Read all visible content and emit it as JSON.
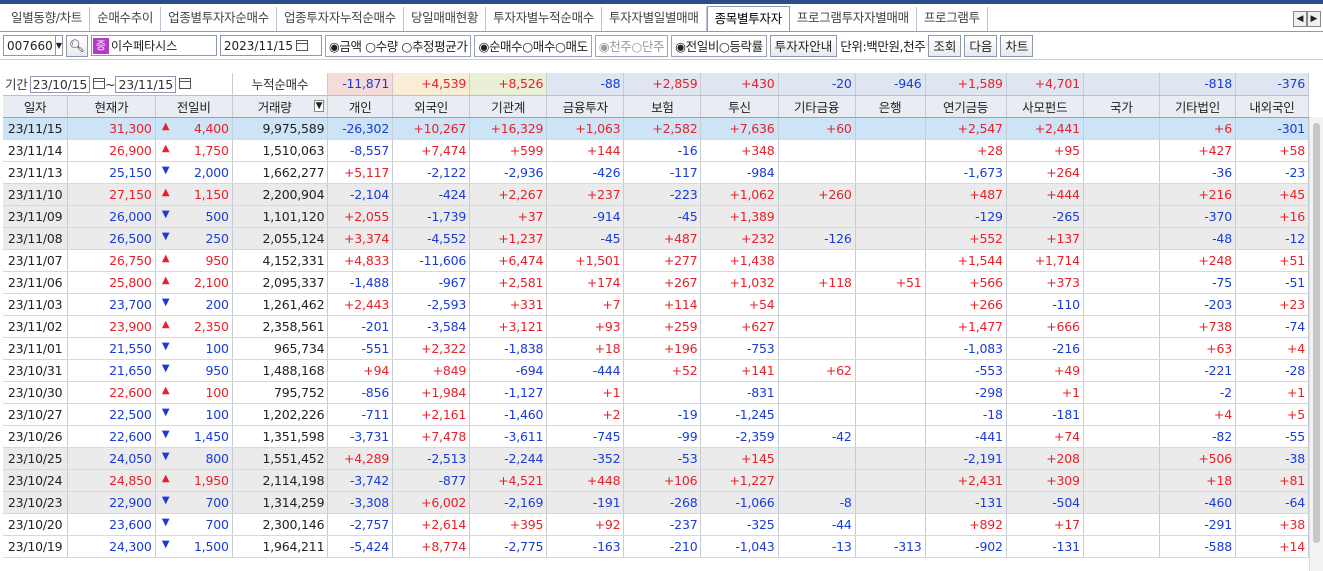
{
  "tabs": [
    "일별동향/차트",
    "순매수추이",
    "업종별투자자순매수",
    "업종투자자누적순매수",
    "당일매매현황",
    "투자자별누적순매수",
    "투자자별일별매매",
    "종목별투자자",
    "프로그램투자자별매매",
    "프로그램투"
  ],
  "active_tab": 7,
  "toolbar": {
    "code": "007660",
    "badge": "증",
    "name": "이수페타시스",
    "date": "2023/11/15",
    "r1": "◉금액 ○수량 ○추정평균가",
    "r2": "◉순매수○매수○매도",
    "r3": "◉천주○단주",
    "r4": "◉전일비○등락률",
    "guide": "투자자안내",
    "unit": "단위:백만원,천주",
    "query": "조회",
    "next": "다음",
    "chart": "차트"
  },
  "period": {
    "label": "기간",
    "from": "23/10/15",
    "to": "23/11/15",
    "cum_label": "누적순매수"
  },
  "summary": [
    "-11,871",
    "+4,539",
    "+8,526",
    "-88",
    "+2,859",
    "+430",
    "-20",
    "-946",
    "+1,589",
    "+4,701",
    "",
    "-818",
    "-376"
  ],
  "columns": [
    "일자",
    "현재가",
    "전일비",
    "거래량",
    "개인",
    "외국인",
    "기관계",
    "금융투자",
    "보험",
    "투신",
    "기타금융",
    "은행",
    "연기금등",
    "사모펀드",
    "국가",
    "기타법인",
    "내외국인"
  ],
  "rows": [
    {
      "date": "23/11/15",
      "price": "31,300",
      "dir": "up",
      "chg": "4,400",
      "vol": "9,975,589",
      "v": [
        "-26,302",
        "+10,267",
        "+16,329",
        "+1,063",
        "+2,582",
        "+7,636",
        "+60",
        "",
        "+2,547",
        "+2,441",
        "",
        "+6",
        "-301"
      ]
    },
    {
      "date": "23/11/14",
      "price": "26,900",
      "dir": "up",
      "chg": "1,750",
      "vol": "1,510,063",
      "v": [
        "-8,557",
        "+7,474",
        "+599",
        "+144",
        "-16",
        "+348",
        "",
        "",
        "+28",
        "+95",
        "",
        "+427",
        "+58"
      ]
    },
    {
      "date": "23/11/13",
      "price": "25,150",
      "dir": "down",
      "chg": "2,000",
      "vol": "1,662,277",
      "v": [
        "+5,117",
        "-2,122",
        "-2,936",
        "-426",
        "-117",
        "-984",
        "",
        "",
        "-1,673",
        "+264",
        "",
        "-36",
        "-23"
      ]
    },
    {
      "date": "23/11/10",
      "price": "27,150",
      "dir": "up",
      "chg": "1,150",
      "vol": "2,200,904",
      "v": [
        "-2,104",
        "-424",
        "+2,267",
        "+237",
        "-223",
        "+1,062",
        "+260",
        "",
        "+487",
        "+444",
        "",
        "+216",
        "+45"
      ]
    },
    {
      "date": "23/11/09",
      "price": "26,000",
      "dir": "down",
      "chg": "500",
      "vol": "1,101,120",
      "v": [
        "+2,055",
        "-1,739",
        "+37",
        "-914",
        "-45",
        "+1,389",
        "",
        "",
        "-129",
        "-265",
        "",
        "-370",
        "+16"
      ]
    },
    {
      "date": "23/11/08",
      "price": "26,500",
      "dir": "down",
      "chg": "250",
      "vol": "2,055,124",
      "v": [
        "+3,374",
        "-4,552",
        "+1,237",
        "-45",
        "+487",
        "+232",
        "-126",
        "",
        "+552",
        "+137",
        "",
        "-48",
        "-12"
      ]
    },
    {
      "date": "23/11/07",
      "price": "26,750",
      "dir": "up",
      "chg": "950",
      "vol": "4,152,331",
      "v": [
        "+4,833",
        "-11,606",
        "+6,474",
        "+1,501",
        "+277",
        "+1,438",
        "",
        "",
        "+1,544",
        "+1,714",
        "",
        "+248",
        "+51"
      ]
    },
    {
      "date": "23/11/06",
      "price": "25,800",
      "dir": "up",
      "chg": "2,100",
      "vol": "2,095,337",
      "v": [
        "-1,488",
        "-967",
        "+2,581",
        "+174",
        "+267",
        "+1,032",
        "+118",
        "+51",
        "+566",
        "+373",
        "",
        "-75",
        "-51"
      ]
    },
    {
      "date": "23/11/03",
      "price": "23,700",
      "dir": "down",
      "chg": "200",
      "vol": "1,261,462",
      "v": [
        "+2,443",
        "-2,593",
        "+331",
        "+7",
        "+114",
        "+54",
        "",
        "",
        "+266",
        "-110",
        "",
        "-203",
        "+23"
      ]
    },
    {
      "date": "23/11/02",
      "price": "23,900",
      "dir": "up",
      "chg": "2,350",
      "vol": "2,358,561",
      "v": [
        "-201",
        "-3,584",
        "+3,121",
        "+93",
        "+259",
        "+627",
        "",
        "",
        "+1,477",
        "+666",
        "",
        "+738",
        "-74"
      ]
    },
    {
      "date": "23/11/01",
      "price": "21,550",
      "dir": "down",
      "chg": "100",
      "vol": "965,734",
      "v": [
        "-551",
        "+2,322",
        "-1,838",
        "+18",
        "+196",
        "-753",
        "",
        "",
        "-1,083",
        "-216",
        "",
        "+63",
        "+4"
      ]
    },
    {
      "date": "23/10/31",
      "price": "21,650",
      "dir": "down",
      "chg": "950",
      "vol": "1,488,168",
      "v": [
        "+94",
        "+849",
        "-694",
        "-444",
        "+52",
        "+141",
        "+62",
        "",
        "-553",
        "+49",
        "",
        "-221",
        "-28"
      ]
    },
    {
      "date": "23/10/30",
      "price": "22,600",
      "dir": "up",
      "chg": "100",
      "vol": "795,752",
      "v": [
        "-856",
        "+1,984",
        "-1,127",
        "+1",
        "",
        "-831",
        "",
        "",
        "-298",
        "+1",
        "",
        "-2",
        "+1"
      ]
    },
    {
      "date": "23/10/27",
      "price": "22,500",
      "dir": "down",
      "chg": "100",
      "vol": "1,202,226",
      "v": [
        "-711",
        "+2,161",
        "-1,460",
        "+2",
        "-19",
        "-1,245",
        "",
        "",
        "-18",
        "-181",
        "",
        "+4",
        "+5"
      ]
    },
    {
      "date": "23/10/26",
      "price": "22,600",
      "dir": "down",
      "chg": "1,450",
      "vol": "1,351,598",
      "v": [
        "-3,731",
        "+7,478",
        "-3,611",
        "-745",
        "-99",
        "-2,359",
        "-42",
        "",
        "-441",
        "+74",
        "",
        "-82",
        "-55"
      ]
    },
    {
      "date": "23/10/25",
      "price": "24,050",
      "dir": "down",
      "chg": "800",
      "vol": "1,551,452",
      "v": [
        "+4,289",
        "-2,513",
        "-2,244",
        "-352",
        "-53",
        "+145",
        "",
        "",
        "-2,191",
        "+208",
        "",
        "+506",
        "-38"
      ]
    },
    {
      "date": "23/10/24",
      "price": "24,850",
      "dir": "up",
      "chg": "1,950",
      "vol": "2,114,198",
      "v": [
        "-3,742",
        "-877",
        "+4,521",
        "+448",
        "+106",
        "+1,227",
        "",
        "",
        "+2,431",
        "+309",
        "",
        "+18",
        "+81"
      ]
    },
    {
      "date": "23/10/23",
      "price": "22,900",
      "dir": "down",
      "chg": "700",
      "vol": "1,314,259",
      "v": [
        "-3,308",
        "+6,002",
        "-2,169",
        "-191",
        "-268",
        "-1,066",
        "-8",
        "",
        "-131",
        "-504",
        "",
        "-460",
        "-64"
      ]
    },
    {
      "date": "23/10/20",
      "price": "23,600",
      "dir": "down",
      "chg": "700",
      "vol": "2,300,146",
      "v": [
        "-2,757",
        "+2,614",
        "+395",
        "+92",
        "-237",
        "-325",
        "-44",
        "",
        "+892",
        "+17",
        "",
        "-291",
        "+38"
      ]
    },
    {
      "date": "23/10/19",
      "price": "24,300",
      "dir": "down",
      "chg": "1,500",
      "vol": "1,964,211",
      "v": [
        "-5,424",
        "+8,774",
        "-2,775",
        "-163",
        "-210",
        "-1,043",
        "-13",
        "-313",
        "-902",
        "-131",
        "",
        "-588",
        "+14"
      ]
    }
  ],
  "colors": {
    "up": "#e8202a",
    "down": "#1a3bd6",
    "selected_row": "#cde4f7",
    "gray_row": "#ebebeb"
  }
}
